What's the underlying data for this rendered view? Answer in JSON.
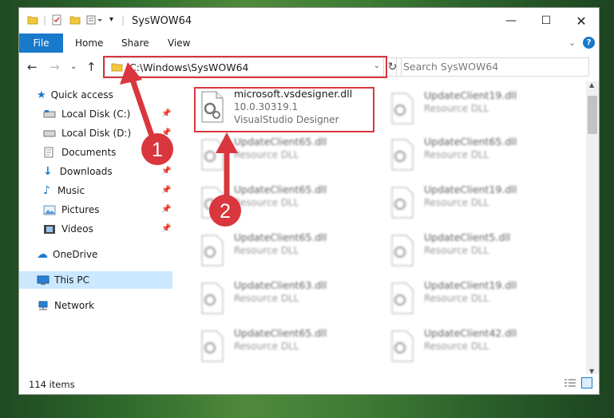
{
  "window": {
    "title": "SysWOW64"
  },
  "ribbon": {
    "file": "File",
    "home": "Home",
    "share": "Share",
    "view": "View"
  },
  "address": {
    "path": "C:\\Windows\\SysWOW64",
    "search_placeholder": "Search SysWOW64"
  },
  "nav": {
    "quick_access": "Quick access",
    "items": [
      {
        "label": "Local Disk (C:)",
        "icon": "drive-icon",
        "pinned": true
      },
      {
        "label": "Local Disk (D:)",
        "icon": "drive-icon",
        "pinned": true
      },
      {
        "label": "Documents",
        "icon": "documents-icon",
        "pinned": true
      },
      {
        "label": "Downloads",
        "icon": "downloads-icon",
        "pinned": true
      },
      {
        "label": "Music",
        "icon": "music-icon",
        "pinned": true
      },
      {
        "label": "Pictures",
        "icon": "pictures-icon",
        "pinned": true
      },
      {
        "label": "Videos",
        "icon": "videos-icon",
        "pinned": true
      }
    ],
    "onedrive": "OneDrive",
    "this_pc": "This PC",
    "network": "Network"
  },
  "files": [
    {
      "name": "microsoft.vsdesigner.dll",
      "version": "10.0.30319.1",
      "desc": "VisualStudio Designer",
      "highlighted": true
    },
    {
      "name": "UpdateClient19.dll",
      "desc": "Resource DLL"
    },
    {
      "name": "UpdateClient65.dll",
      "desc": "Resource DLL"
    },
    {
      "name": "UpdateClient65.dll",
      "desc": "Resource DLL"
    },
    {
      "name": "UpdateClient65.dll",
      "desc": "Resource DLL"
    },
    {
      "name": "UpdateClient19.dll",
      "desc": "Resource DLL"
    },
    {
      "name": "UpdateClient65.dll",
      "desc": "Resource DLL"
    },
    {
      "name": "UpdateClient5.dll",
      "desc": "Resource DLL"
    },
    {
      "name": "UpdateClient63.dll",
      "desc": "Resource DLL"
    },
    {
      "name": "UpdateClient19.dll",
      "desc": "Resource DLL"
    },
    {
      "name": "UpdateClient65.dll",
      "desc": "Resource DLL"
    },
    {
      "name": "UpdateClient42.dll",
      "desc": "Resource DLL"
    }
  ],
  "status": {
    "count": "114 items"
  },
  "annotations": {
    "step1": "1",
    "step2": "2"
  },
  "colors": {
    "accent": "#1979ca",
    "highlight": "#d9363e",
    "selected": "#cce8ff"
  }
}
